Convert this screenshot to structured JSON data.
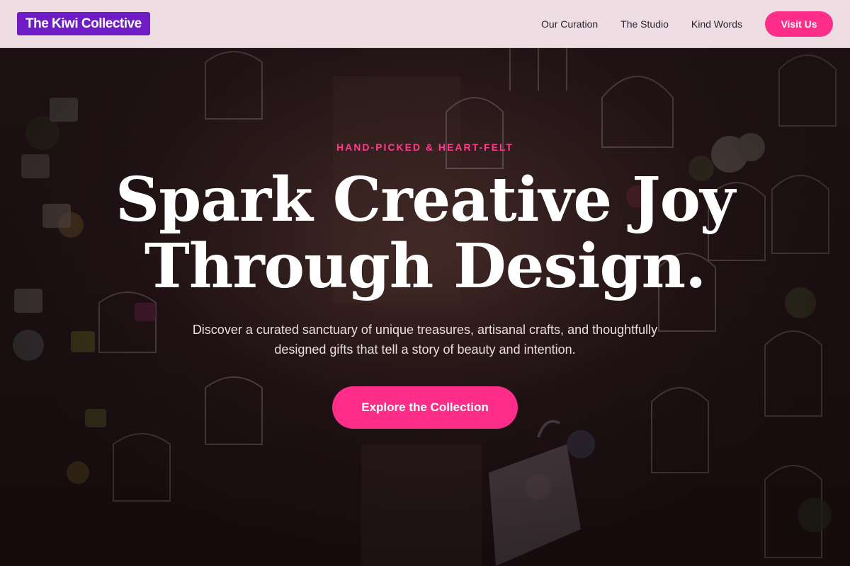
{
  "header": {
    "logo": "The Kiwi Collective",
    "nav": [
      {
        "label": "Our Curation"
      },
      {
        "label": "The Studio"
      },
      {
        "label": "Kind Words"
      }
    ],
    "cta_label": "Visit Us"
  },
  "hero": {
    "eyebrow": "HAND-PICKED & HEART-FELT",
    "headline_line1": "Spark Creative Joy",
    "headline_line2": "Through Design.",
    "subline": "Discover a curated sanctuary of unique treasures, artisanal crafts, and thoughtfully designed gifts that tell a story of beauty and intention.",
    "cta_label": "Explore the Collection"
  },
  "colors": {
    "accent_pink": "#ff2d8a",
    "logo_purple": "#6f1cc7",
    "header_bg": "#eedde2"
  }
}
